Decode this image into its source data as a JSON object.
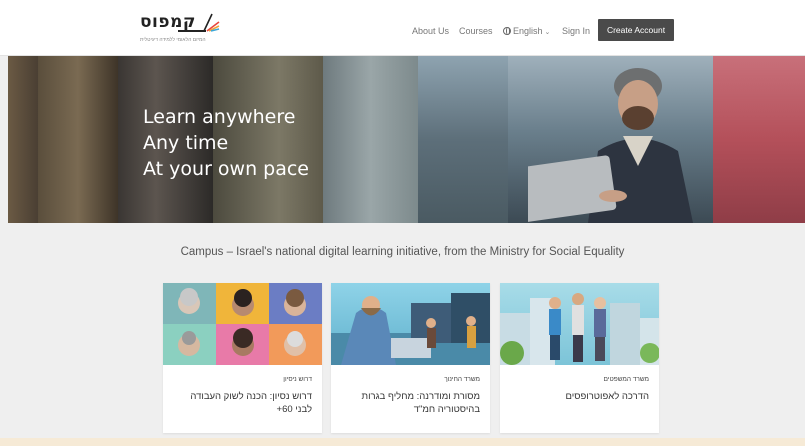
{
  "header": {
    "logo_text": "קמפוס",
    "logo_subtitle": "המיזם הלאומי ללמידה דיגיטלית",
    "nav": {
      "about": "About Us",
      "courses": "Courses",
      "language": "English",
      "sign_in": "Sign In",
      "create_account": "Create Account"
    }
  },
  "hero": {
    "lines": [
      "Learn anywhere",
      "Any time",
      "At your own pace"
    ]
  },
  "tagline": "Campus – Israel's national digital learning initiative, from the Ministry for Social Equality",
  "cards": [
    {
      "org": "דרוש ניסיון",
      "title": "דרוש נסיון: הכנה לשוק העבודה לבני 60+"
    },
    {
      "org": "משרד החינוך",
      "title": "מסורת ומודרנה: מחליף בגרות בהיסטוריה חמ\"ד"
    },
    {
      "org": "משרד המשפטים",
      "title": "הדרכה לאפוטרופסים"
    }
  ],
  "colors": {
    "header_bg": "#ffffff",
    "button_bg": "#4a4a4a",
    "page_bg": "#efefef",
    "hero_overlay_right": "#b4505a"
  },
  "icons": {
    "language": "globe-icon",
    "dropdown": "chevron-down-icon"
  }
}
